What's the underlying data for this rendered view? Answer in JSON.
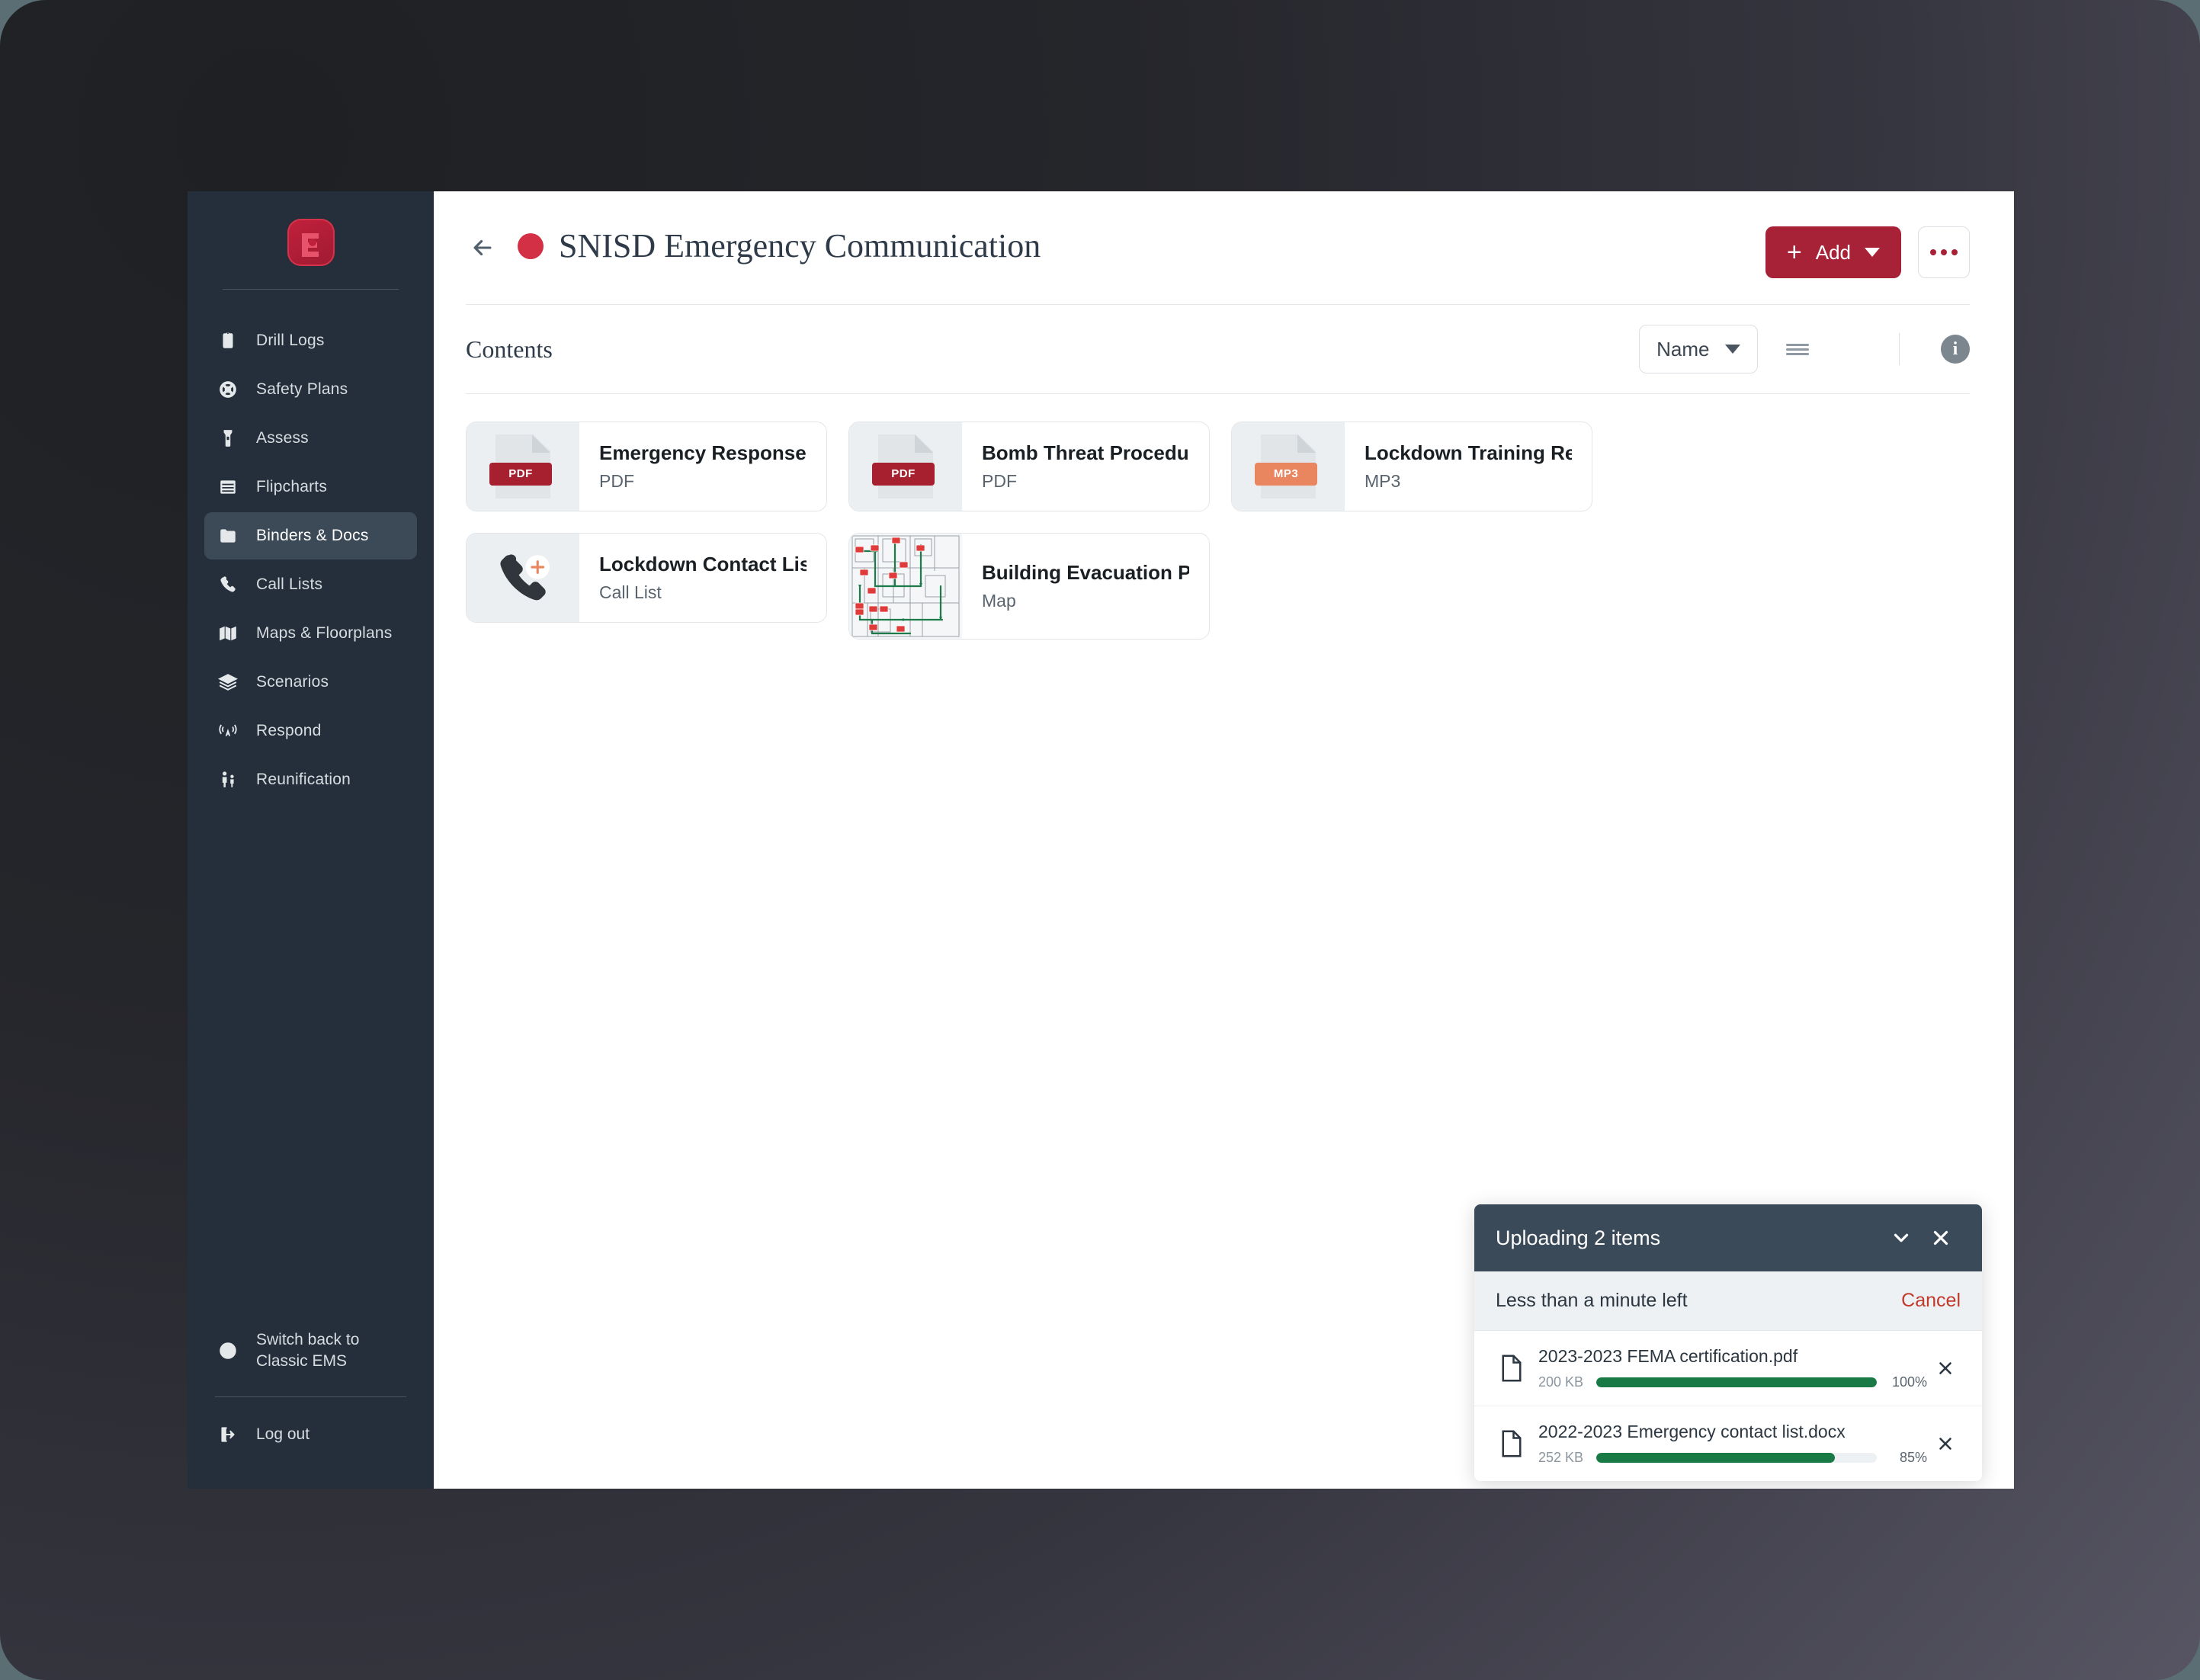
{
  "app": {
    "logo_icon": "ems-logo-icon"
  },
  "sidebar": {
    "items": [
      {
        "label": "Drill Logs",
        "icon": "clipboard-icon",
        "active": false
      },
      {
        "label": "Safety Plans",
        "icon": "lifering-icon",
        "active": false
      },
      {
        "label": "Assess",
        "icon": "flashlight-icon",
        "active": false
      },
      {
        "label": "Flipcharts",
        "icon": "flipchart-icon",
        "active": false
      },
      {
        "label": "Binders & Docs",
        "icon": "folder-icon",
        "active": true
      },
      {
        "label": "Call Lists",
        "icon": "phone-icon",
        "active": false
      },
      {
        "label": "Maps & Floorplans",
        "icon": "map-icon",
        "active": false
      },
      {
        "label": "Scenarios",
        "icon": "layers-icon",
        "active": false
      },
      {
        "label": "Respond",
        "icon": "broadcast-icon",
        "active": false
      },
      {
        "label": "Reunification",
        "icon": "family-icon",
        "active": false
      }
    ],
    "switch_back": "Switch back to Classic EMS",
    "logout": "Log out"
  },
  "header": {
    "back_icon": "arrow-left-icon",
    "status_dot_color": "#d32f45",
    "title": "SNISD Emergency Communication",
    "add_label": "Add",
    "add_color": "#a72137",
    "more_icon": "ellipsis-icon"
  },
  "toolbar": {
    "contents_label": "Contents",
    "sort_value": "Name",
    "sort_options": [
      "Name"
    ],
    "view_list_icon": "list-view-icon",
    "view_grid_icon": "grid-view-icon",
    "active_view": "grid",
    "info_icon": "info-icon"
  },
  "contents": {
    "items": [
      {
        "title": "Emergency Response G...",
        "type": "PDF",
        "thumb": "pdf-file-icon"
      },
      {
        "title": "Bomb Threat Procedures",
        "type": "PDF",
        "thumb": "pdf-file-icon"
      },
      {
        "title": "Lockdown Training Rec...",
        "type": "MP3",
        "thumb": "mp3-file-icon"
      },
      {
        "title": "Lockdown Contact List",
        "type": "Call List",
        "thumb": "phone-plus-icon"
      },
      {
        "title": "Building Evacuation Plan",
        "type": "Map",
        "thumb": "floorplan-thumbnail"
      }
    ]
  },
  "upload_panel": {
    "title": "Uploading 2 items",
    "collapse_icon": "chevron-down-icon",
    "close_icon": "close-icon",
    "status": "Less than a minute left",
    "cancel_label": "Cancel",
    "files": [
      {
        "name": "2023-2023 FEMA certification.pdf",
        "size": "200 KB",
        "percent": "100%",
        "progress": 100
      },
      {
        "name": "2022-2023 Emergency contact list.docx",
        "size": "252 KB",
        "percent": "85%",
        "progress": 85
      }
    ]
  }
}
